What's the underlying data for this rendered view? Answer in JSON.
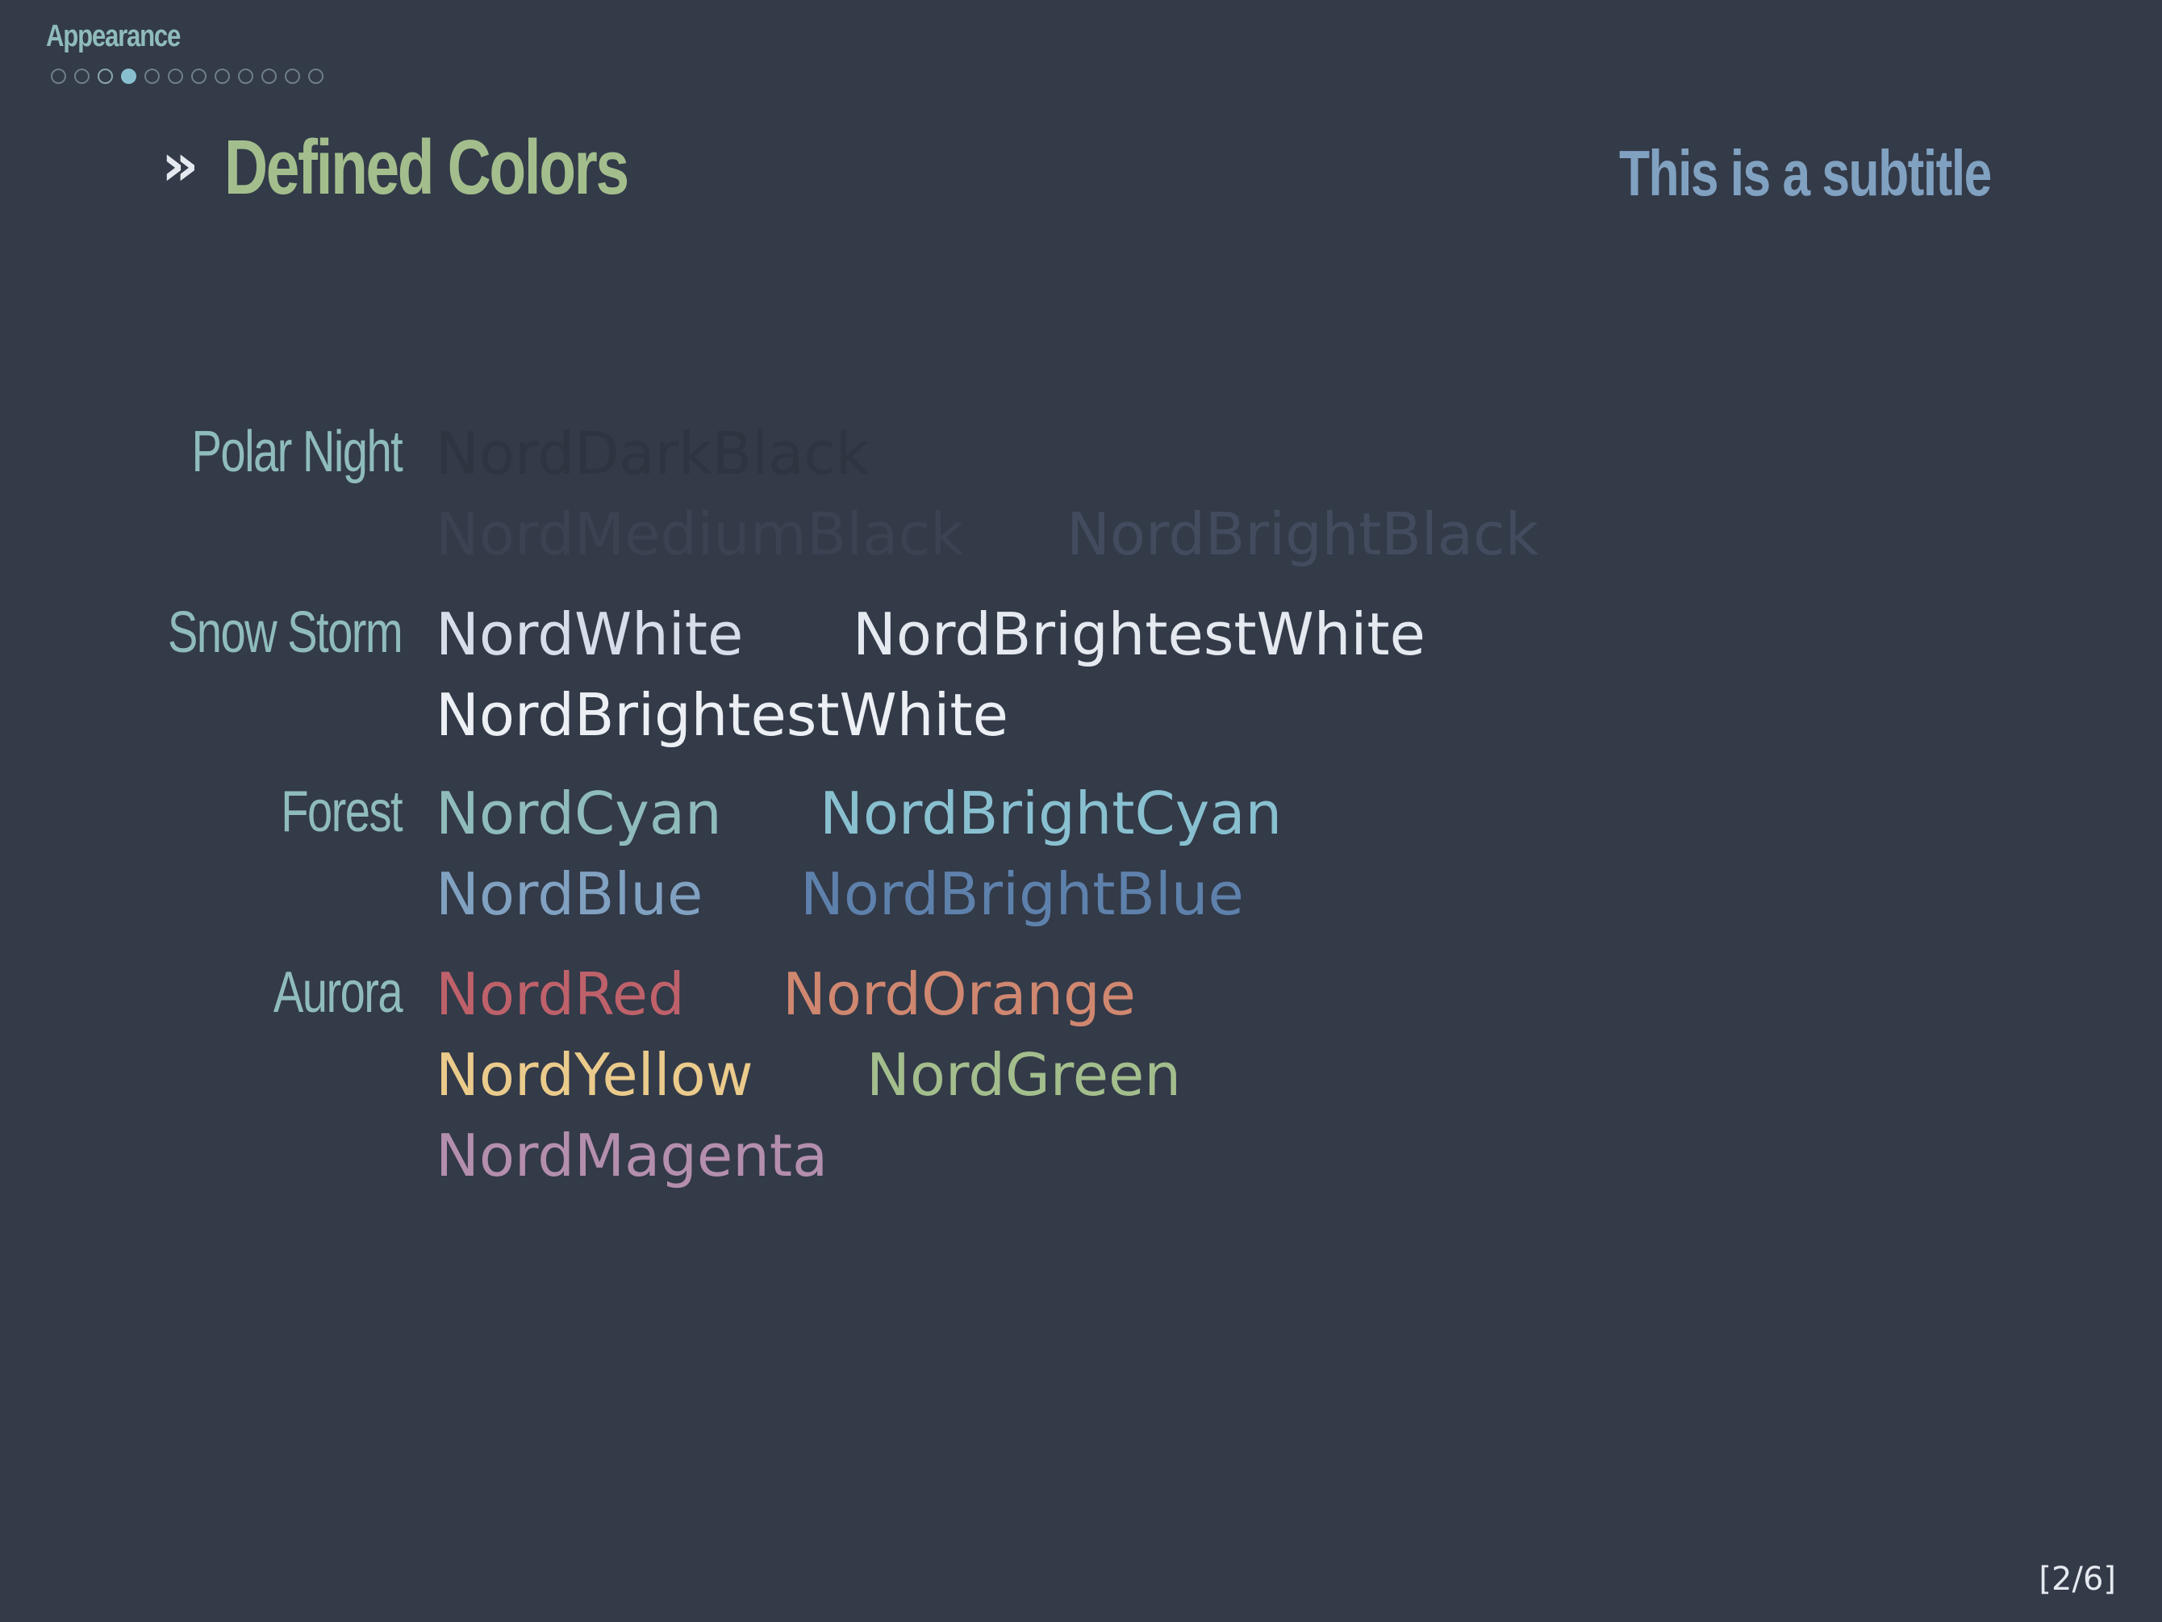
{
  "header": {
    "section_title": "Appearance",
    "navigation": {
      "total": 12,
      "active_index": 3,
      "outline_indices": [
        2
      ]
    }
  },
  "frame": {
    "marker": "»",
    "title": "Defined Colors",
    "subtitle": "This is a subtitle"
  },
  "groups": {
    "polar_night": {
      "label": "Polar Night",
      "items": [
        {
          "name": "NordDarkBlack",
          "color": "#2e3440"
        },
        {
          "name": "NordMediumBlack",
          "color": "#3b4252"
        },
        {
          "name": "NordBrightBlack",
          "color": "#434c5e"
        }
      ]
    },
    "snow_storm": {
      "label": "Snow Storm",
      "items": [
        {
          "name": "NordWhite",
          "color": "#d8dee9"
        },
        {
          "name": "NordBrightestWhite",
          "color": "#e5e9f0"
        },
        {
          "name": "NordBrightestWhite",
          "color": "#eceff4"
        }
      ]
    },
    "forest": {
      "label": "Forest",
      "items": [
        {
          "name": "NordCyan",
          "color": "#8fbcbb"
        },
        {
          "name": "NordBrightCyan",
          "color": "#88c0d0"
        },
        {
          "name": "NordBlue",
          "color": "#81a1c1"
        },
        {
          "name": "NordBrightBlue",
          "color": "#5e81ac"
        }
      ]
    },
    "aurora": {
      "label": "Aurora",
      "items": [
        {
          "name": "NordRed",
          "color": "#bf616a"
        },
        {
          "name": "NordOrange",
          "color": "#d08770"
        },
        {
          "name": "NordYellow",
          "color": "#ebcb8b"
        },
        {
          "name": "NordGreen",
          "color": "#a3be8c"
        },
        {
          "name": "NordMagenta",
          "color": "#b48ead"
        }
      ]
    }
  },
  "footer": {
    "page_counter": "[2/6]"
  }
}
